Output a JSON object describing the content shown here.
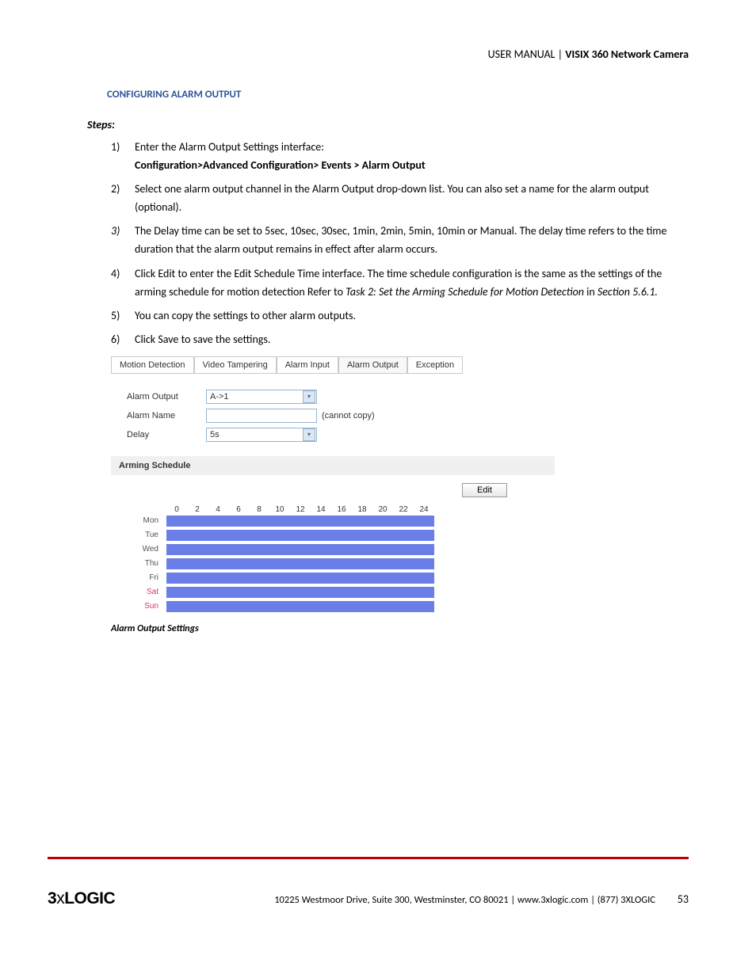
{
  "header": {
    "left": "USER MANUAL |",
    "title": "VISIX 360 Network Camera"
  },
  "section_title": "CONFIGURING ALARM OUTPUT",
  "steps_label": "Steps:",
  "steps": [
    {
      "num": "1)",
      "lead": "Enter the Alarm Output Settings interface:",
      "bold_line": "Configuration>Advanced Configuration> Events > Alarm Output"
    },
    {
      "num": "2)",
      "body": "Select one alarm output channel in the Alarm Output drop-down list. You can also set a name for the alarm output (optional)."
    },
    {
      "num_italic": "3)",
      "body_lead": "The Delay time can be set to 5sec, 10sec, 30sec, 1min, 2min, 5min, 10min or Manual",
      "body_tail": ". The delay time refers to the time duration that the alarm output remains in effect after alarm occurs."
    },
    {
      "num": "4)",
      "body_lead": "Click Edit to enter the Edit Schedule Time interface. The time schedule configuration is the same as the settings of the arming schedule for motion detection Refer to ",
      "task_ref": "Task 2: Set the Arming Schedule for Motion Detection",
      "in_word": " in ",
      "section_ref": "Section 5.6.1."
    },
    {
      "num": "5)",
      "body": "You can copy the settings to other alarm outputs."
    },
    {
      "num": "6)",
      "body": "Click Save to save the settings."
    }
  ],
  "figure": {
    "tabs": [
      "Motion Detection",
      "Video Tampering",
      "Alarm Input",
      "Alarm Output",
      "Exception"
    ],
    "active_tab": 3,
    "form": {
      "alarm_output_label": "Alarm Output",
      "alarm_output_value": "A->1",
      "alarm_name_label": "Alarm Name",
      "alarm_name_value": "",
      "cannot_copy": "(cannot copy)",
      "delay_label": "Delay",
      "delay_value": "5s"
    },
    "arming_label": "Arming Schedule",
    "edit_btn": "Edit",
    "hours": [
      "0",
      "2",
      "4",
      "6",
      "8",
      "10",
      "12",
      "14",
      "16",
      "18",
      "20",
      "22",
      "24"
    ],
    "days": [
      "Mon",
      "Tue",
      "Wed",
      "Thu",
      "Fri",
      "Sat",
      "Sun"
    ]
  },
  "fig_caption": "Alarm Output Settings",
  "footer": {
    "logo": "3xLOGIC",
    "address": "10225 Westmoor Drive, Suite 300, Westminster, CO 80021 | www.3xlogic.com | (877) 3XLOGIC",
    "page": "53"
  }
}
